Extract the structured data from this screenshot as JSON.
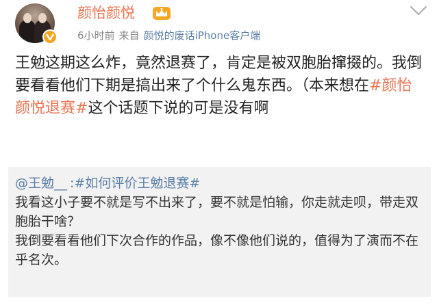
{
  "header": {
    "user_name": "颜怡颜悦",
    "time": "6小时前",
    "source_prefix": "来自",
    "source": "颜悦的废话iPhone客户端"
  },
  "post": {
    "text_before": "王勉这期这么炸，竟然退赛了，肯定是被双胞胎撺掇的。我倒要看看他们下期是搞出来了个什么鬼东西。（本来想在",
    "hashtag": "#颜怡颜悦退赛#",
    "text_after": "这个话题下说的可是没有啊"
  },
  "repost": {
    "mention": "@王勉__",
    "colon": ":",
    "hashtag": "#如何评价王勉退赛#",
    "line1": "我看这小子要不就是写不出来了，要不就是怕输，你走就走呗，带走双胞胎干啥？",
    "line2": "我倒要看看他们下次合作的作品，像不像他们说的，值得为了演而不在乎名次。"
  },
  "colors": {
    "accent": "#eb7350",
    "link": "#5b7fa8",
    "repost_bg": "#f2f2f2"
  },
  "icons": {
    "avatar": "avatar",
    "badge": "verified-badge-icon",
    "crown": "crown-icon",
    "chevron": "chevron-down-icon"
  }
}
